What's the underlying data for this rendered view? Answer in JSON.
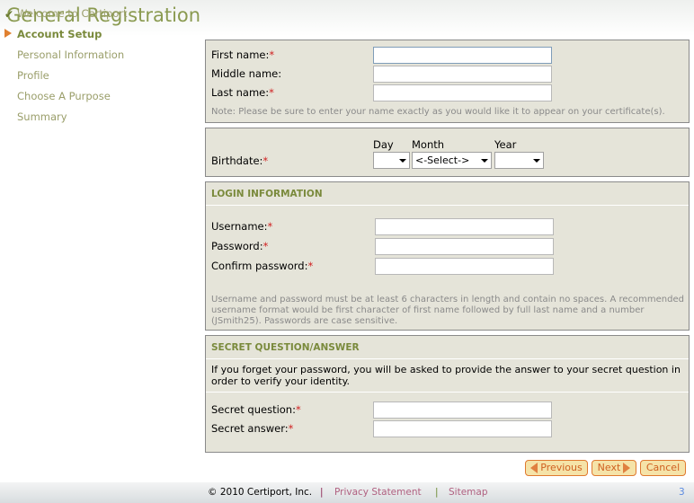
{
  "title": "General Registration",
  "sidebar": {
    "items": [
      {
        "label": "Welcome to Certiport",
        "state": "done"
      },
      {
        "label": "Account Setup",
        "state": "active"
      },
      {
        "label": "Personal Information"
      },
      {
        "label": "Profile"
      },
      {
        "label": "Choose A Purpose"
      },
      {
        "label": "Summary"
      }
    ]
  },
  "name_section": {
    "first": "First name:",
    "middle": "Middle name:",
    "last": "Last name:",
    "note": "Note: Please be sure to enter your name exactly as you would like it to appear on your certificate(s)."
  },
  "birth_section": {
    "label": "Birthdate:",
    "day": "Day",
    "month": "Month",
    "year": "Year",
    "day_value": "",
    "month_value": "<-Select->",
    "year_value": ""
  },
  "login_section": {
    "heading": "LOGIN INFORMATION",
    "username": "Username:",
    "password": "Password:",
    "confirm": "Confirm password:",
    "note": "Username and password must be at least 6 characters in length and contain no spaces. A recommended username format would be first character of first name followed by full last name and a number (JSmith25). Passwords are case sensitive."
  },
  "secret_section": {
    "heading": "SECRET QUESTION/ANSWER",
    "info": "If you forget your password, you will be asked to provide the answer to your secret question in order to verify your identity.",
    "question": "Secret question:",
    "answer": "Secret answer:"
  },
  "required_mark": "*",
  "buttons": {
    "previous": "Previous",
    "next": "Next",
    "cancel": "Cancel"
  },
  "footer": {
    "copyright": "© 2010 Certiport, Inc.",
    "sep": "|",
    "privacy": "Privacy Statement",
    "sitemap": "Sitemap",
    "page": "3"
  },
  "colors": {
    "accent": "#8a9a50",
    "required": "#d02020",
    "button_text": "#d06020"
  }
}
